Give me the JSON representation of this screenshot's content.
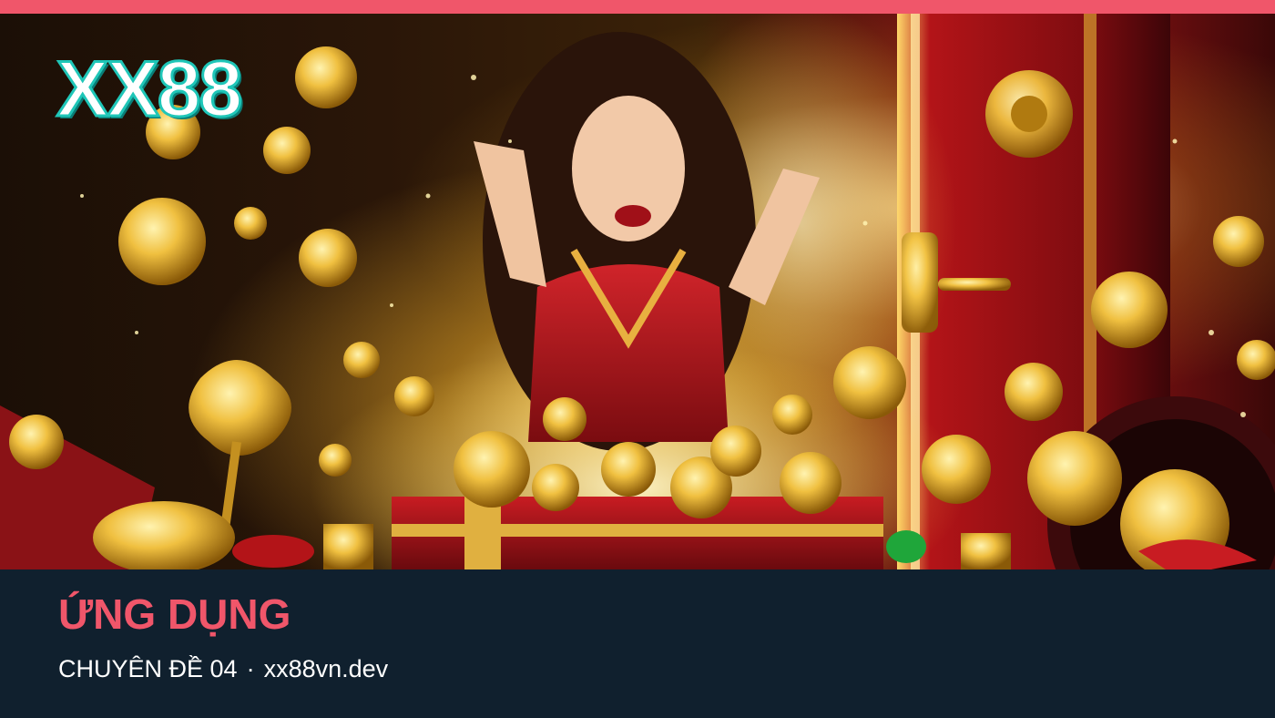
{
  "colors": {
    "accent": "#f0566a",
    "panel_bg": "#10202e",
    "logo_outline": "#1fc6b8",
    "text": "#ffffff"
  },
  "hero": {
    "logo_text": "XX88"
  },
  "footer": {
    "title": "ỨNG DỤNG",
    "topic": "CHUYÊN ĐỀ 04",
    "separator": "·",
    "domain": "xx88vn.dev"
  }
}
